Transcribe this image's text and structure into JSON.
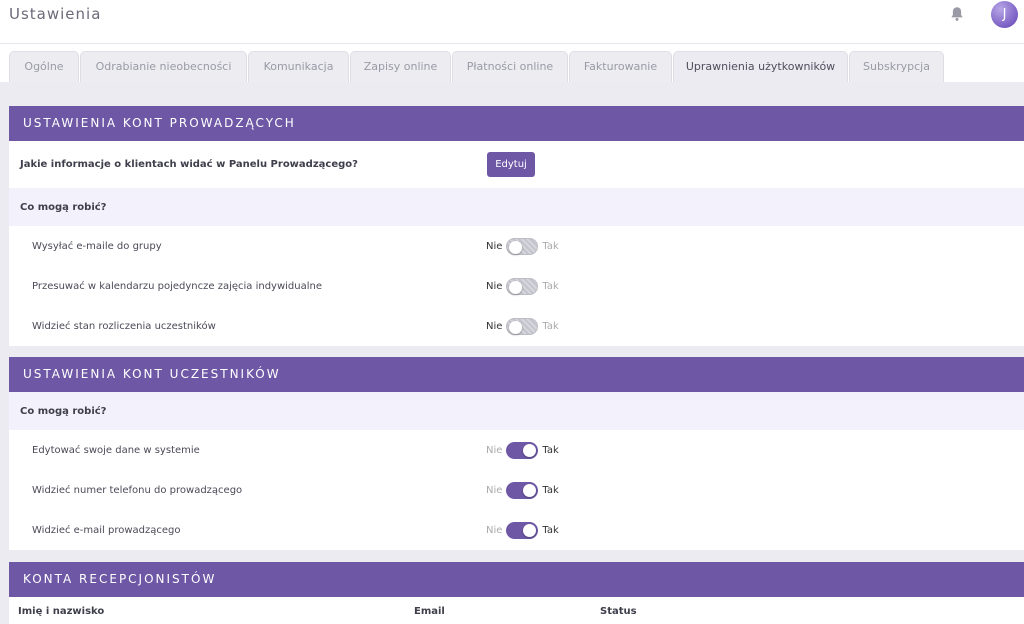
{
  "header": {
    "title": "Ustawienia",
    "bell_icon": "bell-icon",
    "avatar_letter": "J"
  },
  "tabs": [
    {
      "label": "Ogólne"
    },
    {
      "label": "Odrabianie nieobecności"
    },
    {
      "label": "Komunikacja"
    },
    {
      "label": "Zapisy online"
    },
    {
      "label": "Płatności online"
    },
    {
      "label": "Fakturowanie"
    },
    {
      "label": "Uprawnienia użytkowników",
      "active": true
    },
    {
      "label": "Subskrypcja"
    }
  ],
  "toggle_labels": {
    "off": "Nie",
    "on": "Tak"
  },
  "instructors": {
    "title": "USTAWIENIA KONT PROWADZĄCYCH",
    "info_question": "Jakie informacje o klientach widać w Panelu Prowadzącego?",
    "edit_label": "Edytuj",
    "can_do": "Co mogą robić?",
    "options": [
      {
        "label": "Wysyłać e-maile do grupy",
        "enabled": false
      },
      {
        "label": "Przesuwać w kalendarzu pojedyncze zajęcia indywidualne",
        "enabled": false
      },
      {
        "label": "Widzieć stan rozliczenia uczestników",
        "enabled": false
      }
    ]
  },
  "participants": {
    "title": "USTAWIENIA KONT UCZESTNIKÓW",
    "can_do": "Co mogą robić?",
    "options": [
      {
        "label": "Edytować swoje dane w systemie",
        "enabled": true
      },
      {
        "label": "Widzieć numer telefonu do prowadzącego",
        "enabled": true
      },
      {
        "label": "Widzieć e-mail prowadzącego",
        "enabled": true
      }
    ]
  },
  "receptionists": {
    "title": "KONTA RECEPCJONISTÓW",
    "columns": [
      "Imię i nazwisko",
      "Email",
      "Status"
    ]
  },
  "colors": {
    "accent": "#6e58a6",
    "background": "#ecebf2",
    "question_row": "#f3f1fb"
  }
}
